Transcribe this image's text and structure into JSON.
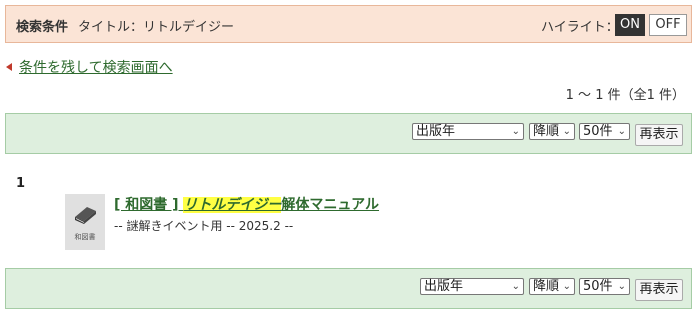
{
  "search_conditions": {
    "label": "検索条件",
    "text": "タイトル：リトルデイジー",
    "highlight_label": "ハイライト：",
    "highlight_on": "ON",
    "highlight_off": "OFF"
  },
  "back_link": "条件を残して検索画面へ",
  "result_count": "1 ～ 1 件（全1 件）",
  "sort_controls": {
    "sort_field": "出版年",
    "sort_order": "降順",
    "per_page": "50件",
    "redisplay": "再表示"
  },
  "results": [
    {
      "number": "1",
      "thumbnail_label": "和図書",
      "title_prefix": "[ 和図書 ] ",
      "title_highlight": "リトルデイジー",
      "title_rest": "解体マニュアル",
      "subtitle": "-- 謎解きイベント用 -- 2025.2 --"
    }
  ],
  "colors": {
    "condition_bg": "#fbe4d6",
    "sort_bar_bg": "#deefde",
    "link": "#2e6a2e",
    "highlight": "#ffff44"
  },
  "icons": {
    "back": "triangle-left-icon",
    "thumbnail": "book-icon"
  }
}
